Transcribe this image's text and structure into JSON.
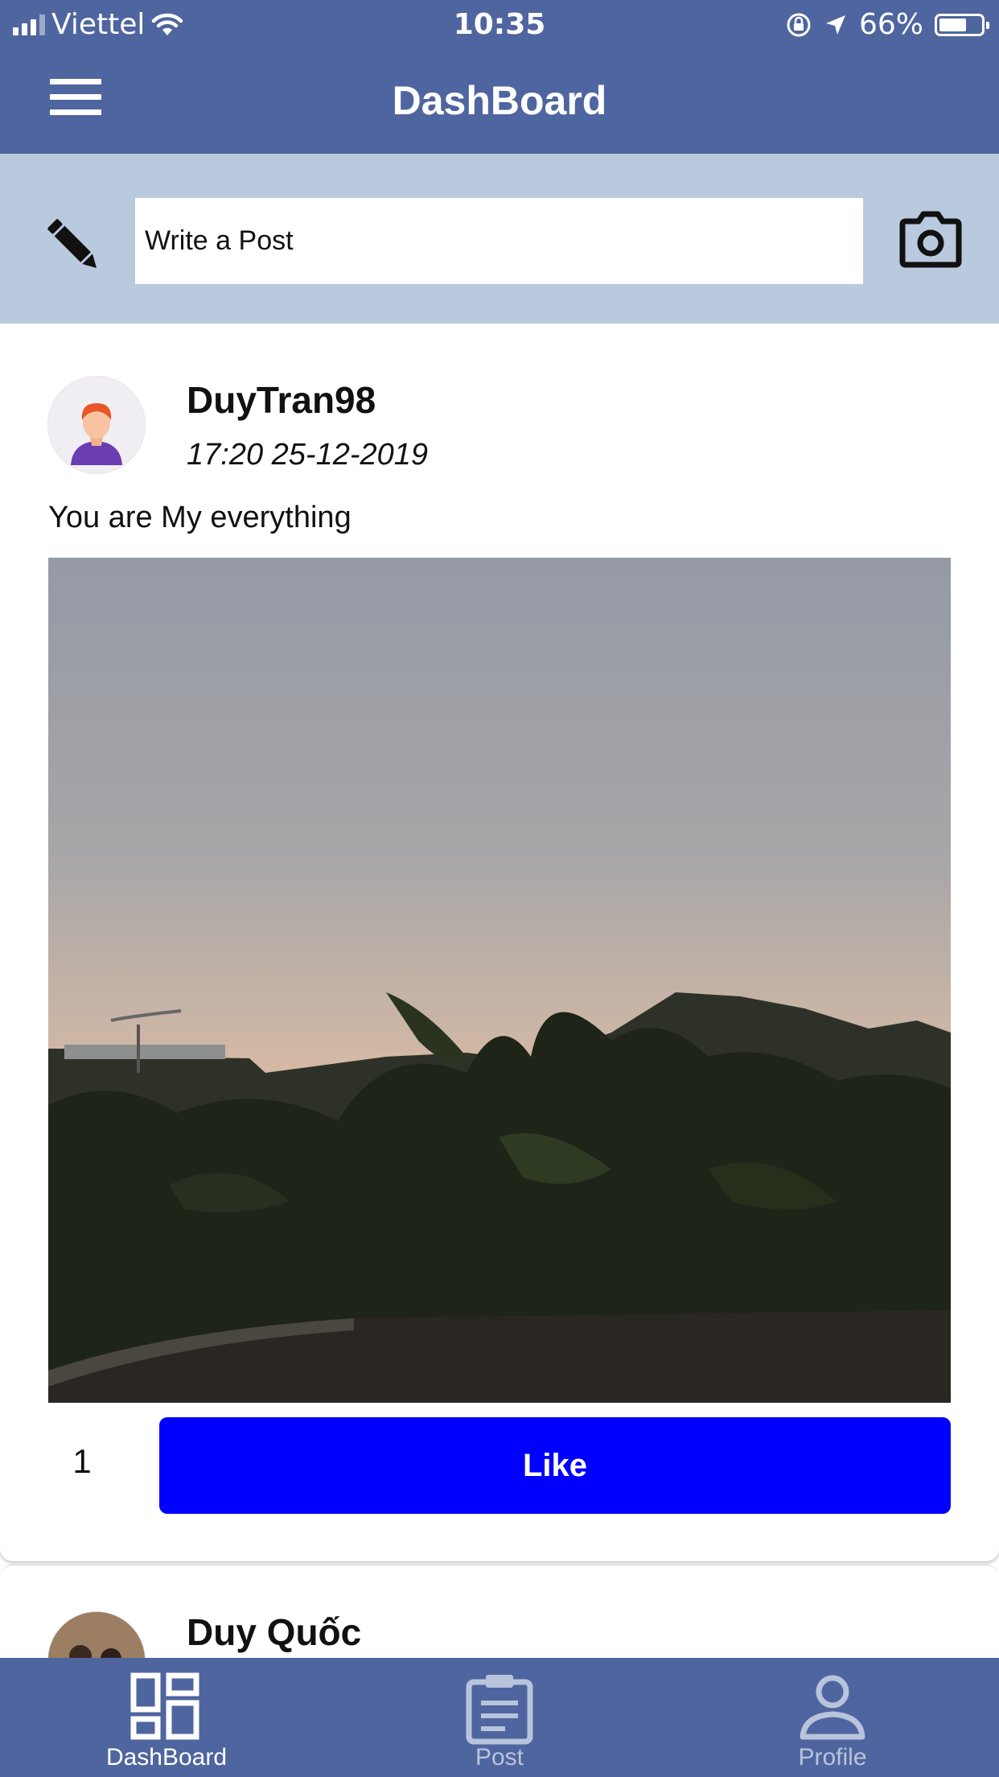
{
  "status_bar": {
    "carrier": "Viettel",
    "time": "10:35",
    "battery_percent": "66%",
    "battery_level": 0.66
  },
  "header": {
    "title": "DashBoard",
    "menu_icon": "hamburger-menu-icon"
  },
  "composer": {
    "placeholder": "Write a Post",
    "left_icon": "pencil-icon",
    "right_icon": "camera-icon"
  },
  "posts": [
    {
      "username": "DuyTran98",
      "date": "17:20 25-12-2019",
      "caption": "You are My everything",
      "like_count": "1",
      "like_label": "Like"
    },
    {
      "username": "Duy Quốc"
    }
  ],
  "tabs": [
    {
      "label": "DashBoard",
      "icon": "dashboard-grid-icon",
      "active": true
    },
    {
      "label": "Post",
      "icon": "clipboard-icon",
      "active": false
    },
    {
      "label": "Profile",
      "icon": "person-icon",
      "active": false
    }
  ],
  "colors": {
    "header_bg": "#4f659f",
    "composer_bg": "#b9c9de",
    "like_button": "#0000ff",
    "inactive_tab": "#b8c4dc"
  }
}
